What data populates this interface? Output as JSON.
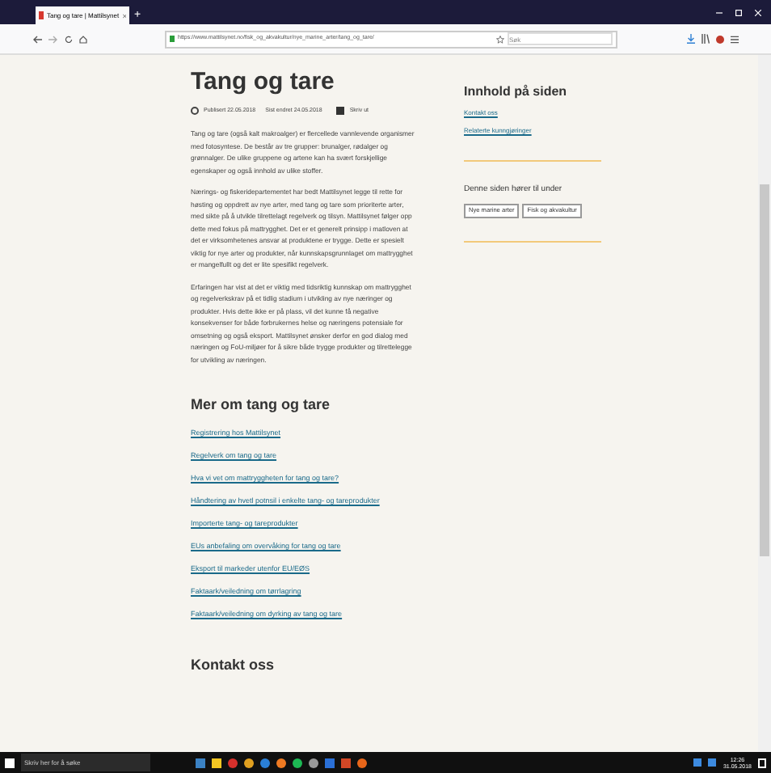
{
  "browser": {
    "tab_title": "Tang og tare | Mattilsynet",
    "new_tab": "+",
    "url": "https://www.mattilsynet.no/fisk_og_akvakultur/nye_marine_arter/tang_og_tare/",
    "search_placeholder": "Søk"
  },
  "article": {
    "title": "Tang og tare",
    "published_label": "Publisert",
    "published": "22.05.2018",
    "edited_label": "Sist endret",
    "edited": "24.05.2018",
    "print": "Skriv ut",
    "paragraphs": [
      "Tang og tare (også kalt makroalger) er flercellede vannlevende organismer med fotosyntese. De består av tre grupper: brunalger, rødalger og grønnalger. De ulike gruppene og artene kan ha svært forskjellige egenskaper og også innhold av ulike stoffer.",
      "Nærings- og fiskeridepartementet har bedt Mattilsynet legge til rette for høsting og oppdrett av nye arter, med tang og tare som prioriterte arter, med sikte på å utvikle tilrettelagt regelverk og tilsyn. Mattilsynet følger opp dette med fokus på mattrygghet. Det er et generelt prinsipp i matloven at det er virksomhetenes ansvar at produktene er trygge. Dette er spesielt viktig for nye arter og produkter, når kunnskapsgrunnlaget om mattrygghet er mangelfullt og det er lite spesifikt regelverk.",
      "Erfaringen har vist at det er viktig med tidsriktig kunnskap om mattrygghet og regelverkskrav på et tidlig stadium i utvikling av nye næringer og produkter. Hvis dette ikke er på plass, vil det kunne få negative konsekvenser for både forbrukernes helse og næringens potensiale for omsetning og også eksport. Mattilsynet ønsker derfor en god dialog med næringen og FoU-miljøer for å sikre både trygge produkter og tilrettelegge for utvikling av næringen."
    ],
    "more_heading": "Mer om tang og tare",
    "links": [
      "Registrering hos Mattilsynet",
      "Regelverk om tang og tare",
      "Hva vi vet om mattryggheten for tang og tare?",
      "Håndtering av hvetl potnsil i enkelte tang- og tareprodukter",
      "Importerte tang- og tareprodukter",
      "EUs anbefaling om overvåking for tang og tare",
      "Eksport til markeder utenfor EU/EØS",
      "Faktaark/veiledning om tørrlagring",
      "Faktaark/veiledning om dyrking av tang og tare"
    ],
    "contact_heading": "Kontakt oss"
  },
  "sidebar": {
    "toc_heading": "Innhold på siden",
    "toc_links": [
      "Kontakt oss",
      "Relaterte kunngjøringer"
    ],
    "belongs_heading": "Denne siden hører til under",
    "tags": [
      "Nye marine arter",
      "Fisk og akvakultur"
    ]
  },
  "taskbar": {
    "search_placeholder": "Skriv her for å søke",
    "time": "12:26",
    "date": "31.05.2018"
  }
}
